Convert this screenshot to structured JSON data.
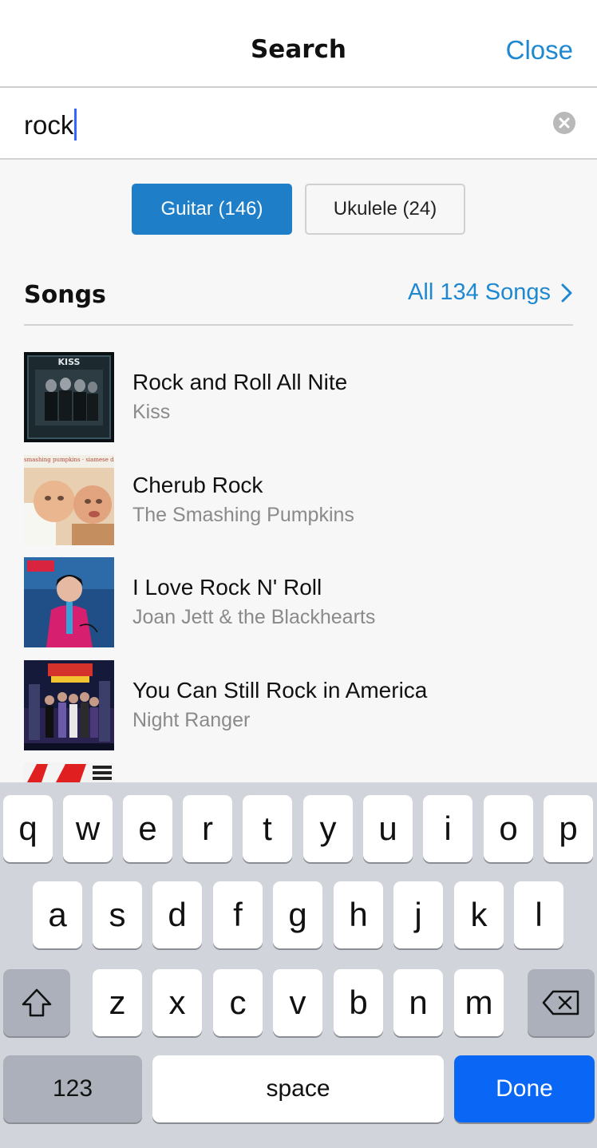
{
  "header": {
    "title": "Search",
    "close_label": "Close"
  },
  "search": {
    "query": "rock"
  },
  "instruments": [
    {
      "label": "Guitar (146)",
      "selected": true
    },
    {
      "label": "Ukulele (24)",
      "selected": false
    }
  ],
  "songs_section": {
    "heading": "Songs",
    "all_link": "All 134 Songs"
  },
  "songs": [
    {
      "title": "Rock and Roll All Nite",
      "artist": "Kiss",
      "art_text": "KISS"
    },
    {
      "title": "Cherub Rock",
      "artist": "The Smashing Pumpkins",
      "art_text": "smashing pumpkins · siamese dream"
    },
    {
      "title": "I Love Rock N' Roll",
      "artist": "Joan Jett & the Blackhearts",
      "art_text": ""
    },
    {
      "title": "You Can Still Rock in America",
      "artist": "Night Ranger",
      "art_text": ""
    }
  ],
  "keyboard": {
    "row1": [
      "q",
      "w",
      "e",
      "r",
      "t",
      "y",
      "u",
      "i",
      "o",
      "p"
    ],
    "row2": [
      "a",
      "s",
      "d",
      "f",
      "g",
      "h",
      "j",
      "k",
      "l"
    ],
    "row3": [
      "z",
      "x",
      "c",
      "v",
      "b",
      "n",
      "m"
    ],
    "numbers_label": "123",
    "space_label": "space",
    "done_label": "Done"
  },
  "colors": {
    "accent": "#1e88d0",
    "segment_selected": "#1e7fc8",
    "done_key": "#0a66f5"
  }
}
